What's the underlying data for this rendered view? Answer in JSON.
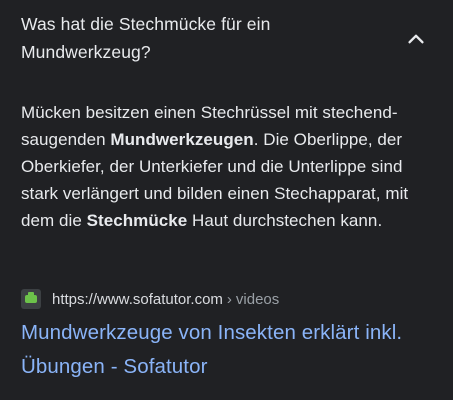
{
  "question": {
    "text": "Was hat die Stechmücke für ein Mundwerkzeug?",
    "toggle_icon": "chevron-up-icon"
  },
  "answer": {
    "seg1": "Mücken besitzen einen Stechrüssel mit stechend-saugenden ",
    "bold1": "Mundwerkzeugen",
    "seg2": ". Die Oberlippe, der Oberkiefer, der Unterkiefer und die Unterlippe sind stark verlängert und bilden einen Stechapparat, mit dem die ",
    "bold2": "Stechmücke",
    "seg3": " Haut durchstechen kann."
  },
  "source": {
    "favicon": "sofatutor-favicon-icon",
    "url": "https://www.sofatutor.com",
    "separator": "›",
    "path": "videos"
  },
  "result": {
    "title": "Mundwerkzeuge von Insekten erklärt inkl. Übungen - Sofatutor"
  },
  "colors": {
    "background": "#202124",
    "text": "#e8eaed",
    "link": "#8ab4f8",
    "muted": "#9aa0a6",
    "favicon_green": "#6cc24a"
  }
}
